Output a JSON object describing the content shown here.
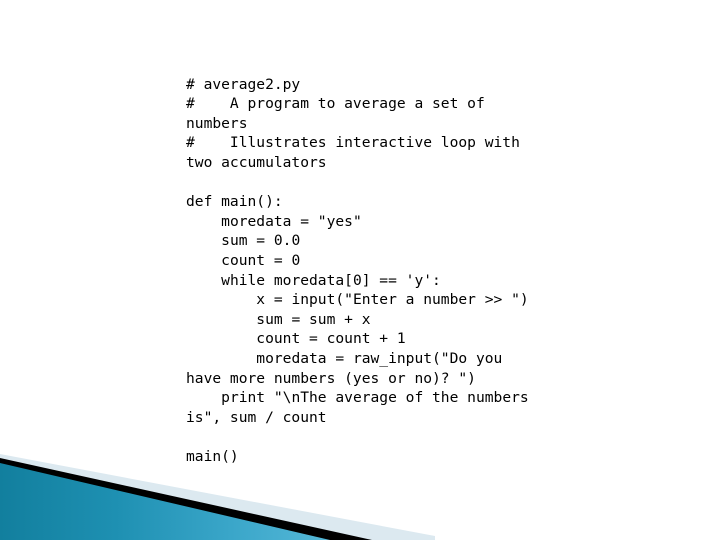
{
  "slide": {
    "background_color": "#ffffff",
    "text_color": "#000000"
  },
  "decoration": {
    "name": "diagonal-corner-bands",
    "teal_dark": "#14819f",
    "teal_light": "#4bb0d2",
    "band_black": "#000000",
    "band_pale_blue": "#dce9f0"
  },
  "code": {
    "language": "python",
    "lines": [
      "# average2.py",
      "#    A program to average a set of numbers",
      "#    Illustrates interactive loop with two accumulators",
      "",
      "def main():",
      "    moredata = \"yes\"",
      "    sum = 0.0",
      "    count = 0",
      "    while moredata[0] == 'y':",
      "        x = input(\"Enter a number >> \")",
      "        sum = sum + x",
      "        count = count + 1",
      "        moredata = raw_input(\"Do you have more numbers (yes or no)? \")",
      "    print \"\\nThe average of the numbers is\", sum / count",
      "",
      "main()"
    ]
  }
}
